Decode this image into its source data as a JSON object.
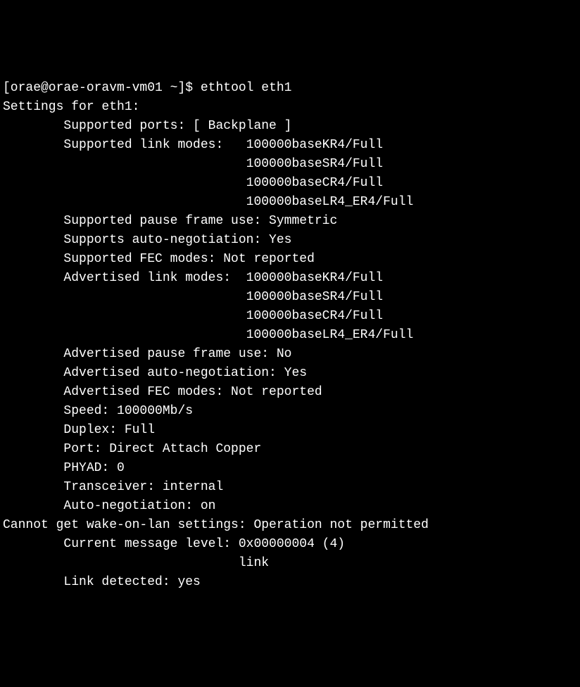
{
  "prompt": {
    "user_host": "[orae@orae-oravm-vm01 ~]$ ",
    "command": "ethtool eth1"
  },
  "output": {
    "header": "Settings for eth1:",
    "supported_ports": "        Supported ports: [ Backplane ]",
    "supported_link_modes_label": "        Supported link modes:   ",
    "supported_modes": [
      "100000baseKR4/Full",
      "                                100000baseSR4/Full",
      "                                100000baseCR4/Full",
      "                                100000baseLR4_ER4/Full"
    ],
    "supported_pause": "        Supported pause frame use: Symmetric",
    "supports_autoneg": "        Supports auto-negotiation: Yes",
    "supported_fec": "        Supported FEC modes: Not reported",
    "advertised_link_modes_label": "        Advertised link modes:  ",
    "advertised_modes": [
      "100000baseKR4/Full",
      "                                100000baseSR4/Full",
      "                                100000baseCR4/Full",
      "                                100000baseLR4_ER4/Full"
    ],
    "advertised_pause": "        Advertised pause frame use: No",
    "advertised_autoneg": "        Advertised auto-negotiation: Yes",
    "advertised_fec": "        Advertised FEC modes: Not reported",
    "speed": "        Speed: 100000Mb/s",
    "duplex": "        Duplex: Full",
    "port": "        Port: Direct Attach Copper",
    "phyad": "        PHYAD: 0",
    "transceiver": "        Transceiver: internal",
    "autoneg": "        Auto-negotiation: on",
    "wol_error": "Cannot get wake-on-lan settings: Operation not permitted",
    "msg_level": "        Current message level: 0x00000004 (4)",
    "msg_level_sub": "                               link",
    "link_detected": "        Link detected: yes"
  }
}
